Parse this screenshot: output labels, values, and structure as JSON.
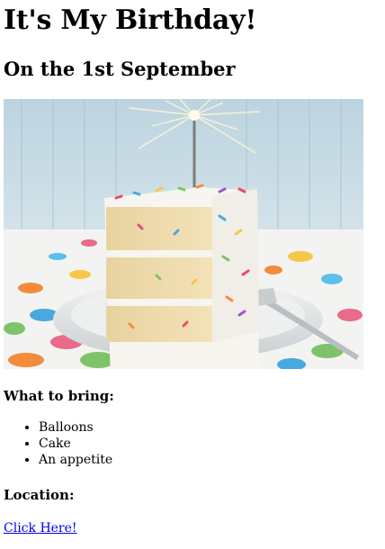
{
  "page": {
    "title": "It's My Birthday!",
    "subtitle": "On the 1st September",
    "image_alt": "Slice of funfetti birthday cake with a sparkler",
    "bring_heading": "What to bring:",
    "bring_items": [
      "Balloons",
      "Cake",
      "An appetite"
    ],
    "location_heading": "Location:",
    "location_link": "Click Here!"
  },
  "colors": {
    "link": "#0000ee",
    "background_top": "#c9dbe6",
    "frosting": "#f7f5ef",
    "sponge": "#f0dcaf"
  }
}
